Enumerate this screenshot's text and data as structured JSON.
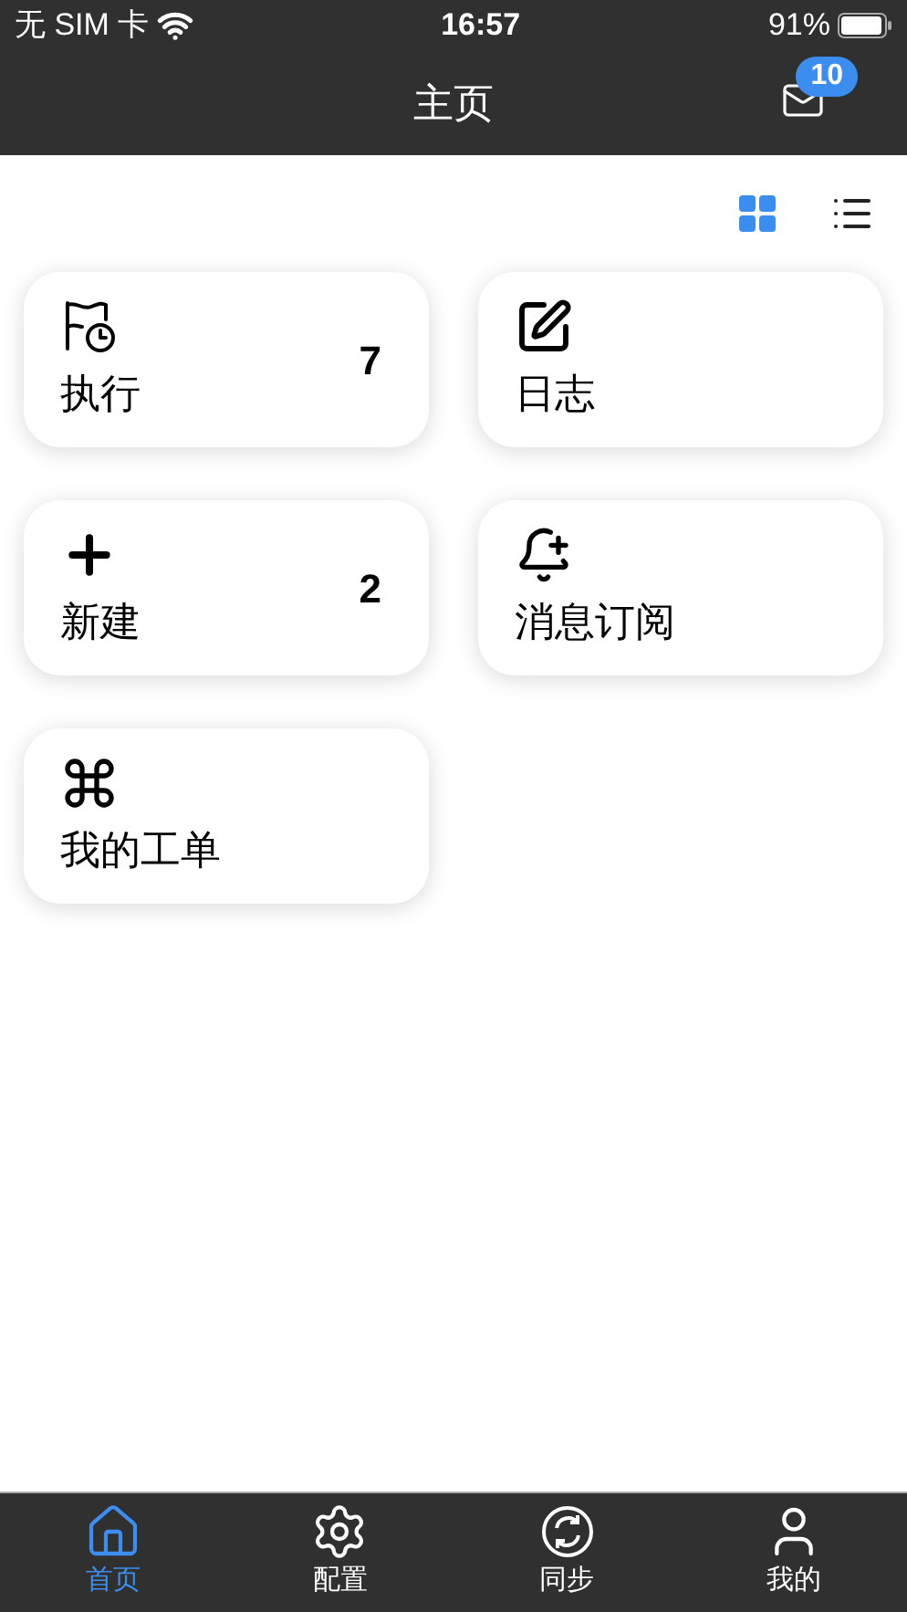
{
  "status_bar": {
    "carrier": "无 SIM 卡",
    "time": "16:57",
    "battery": "91%"
  },
  "nav": {
    "title": "主页",
    "mail_badge": "10"
  },
  "view_toggle": [
    {
      "kind": "grid",
      "selected": true
    },
    {
      "kind": "list",
      "selected": false
    }
  ],
  "cards": [
    {
      "kind": "flag",
      "label": "执行",
      "count": "7"
    },
    {
      "kind": "edit",
      "label": "日志"
    },
    {
      "kind": "plus",
      "label": "新建",
      "count": "2"
    },
    {
      "kind": "bell",
      "label": "消息订阅"
    },
    {
      "kind": "command",
      "label": "我的工单"
    }
  ],
  "tabs": [
    {
      "kind": "home",
      "label": "首页",
      "selected": true
    },
    {
      "kind": "gear",
      "label": "配置",
      "selected": false
    },
    {
      "kind": "sync",
      "label": "同步",
      "selected": false
    },
    {
      "kind": "user",
      "label": "我的",
      "selected": false
    }
  ]
}
